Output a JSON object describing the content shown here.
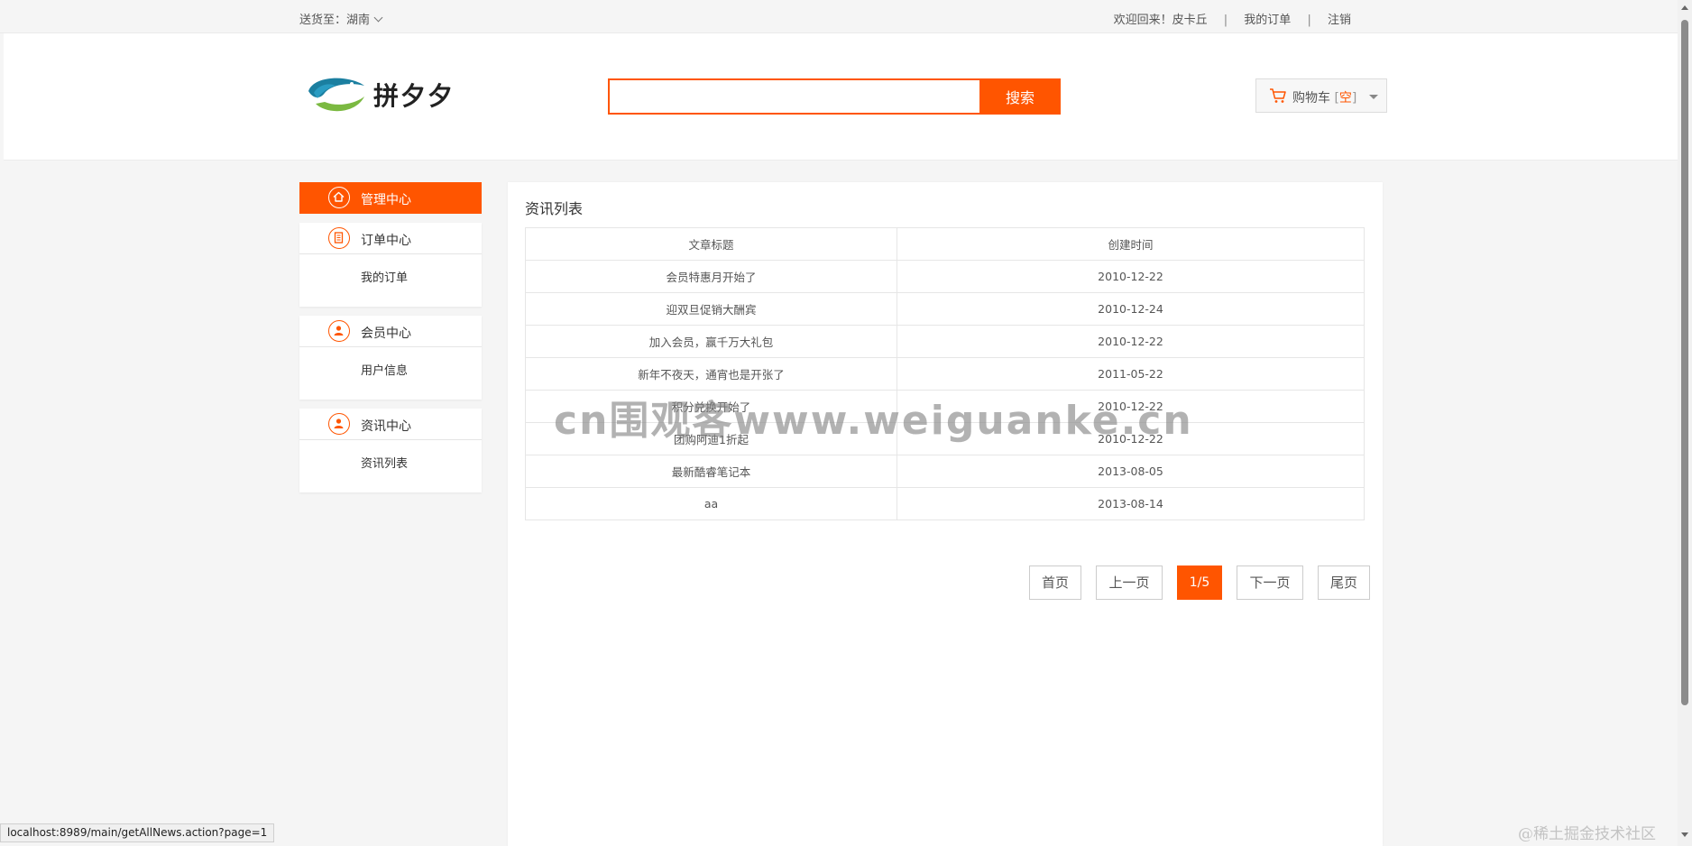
{
  "topbar": {
    "deliver_label": "送货至：湖南",
    "welcome": "欢迎回来！皮卡丘",
    "separator": "|",
    "my_orders": "我的订单",
    "logout": "注销"
  },
  "header": {
    "logo_text": "拼夕夕",
    "search_value": "",
    "search_button": "搜索",
    "cart_label": "购物车",
    "cart_bracket_open": "[",
    "cart_status": "空",
    "cart_bracket_close": "]"
  },
  "sidebar": {
    "active": {
      "label": "管理中心",
      "icon": "home-icon"
    },
    "sections": [
      {
        "label": "订单中心",
        "icon": "document-icon",
        "link": "我的订单"
      },
      {
        "label": "会员中心",
        "icon": "user-icon",
        "link": "用户信息"
      },
      {
        "label": "资讯中心",
        "icon": "user-icon",
        "link": "资讯列表"
      }
    ]
  },
  "content": {
    "title": "资讯列表",
    "columns": [
      "文章标题",
      "创建时间"
    ],
    "rows": [
      [
        "会员特惠月开始了",
        "2010-12-22"
      ],
      [
        "迎双旦促销大酬宾",
        "2010-12-24"
      ],
      [
        "加入会员，赢千万大礼包",
        "2010-12-22"
      ],
      [
        "新年不夜天，通宵也是开张了",
        "2011-05-22"
      ],
      [
        "积分兑换开始了",
        "2010-12-22"
      ],
      [
        "团购阿迪1折起",
        "2010-12-22"
      ],
      [
        "最新酷睿笔记本",
        "2013-08-05"
      ],
      [
        "aa",
        "2013-08-14"
      ]
    ],
    "pagination": {
      "first": "首页",
      "prev": "上一页",
      "current": "1/5",
      "next": "下一页",
      "last": "尾页"
    }
  },
  "watermark": "cn围观客www.weiguanke.cn",
  "status_url": "localhost:8989/main/getAllNews.action?page=1",
  "credit": "@稀土掘金技术社区",
  "colors": {
    "accent": "#ff5500",
    "logo_blue": "#1b7fa0",
    "logo_green": "#7bb941"
  }
}
